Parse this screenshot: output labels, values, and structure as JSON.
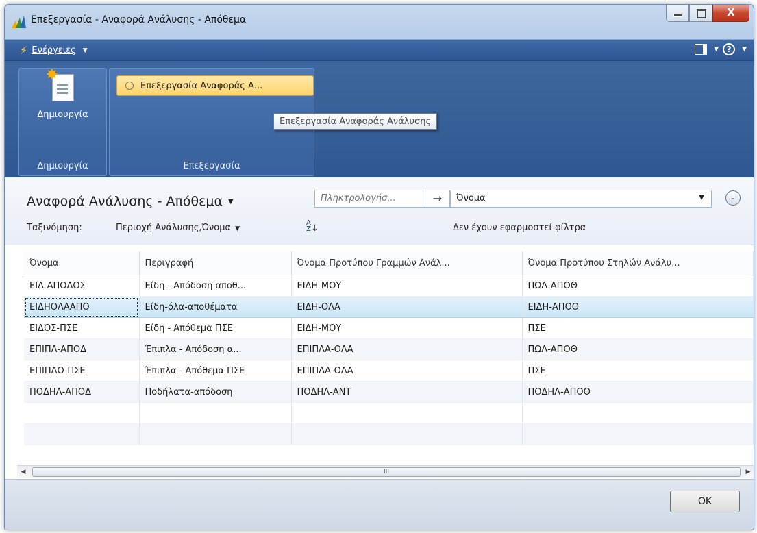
{
  "window": {
    "title": "Επεξεργασία - Αναφορά Ανάλυσης - Απόθεμα",
    "close_glyph": "X"
  },
  "actions_bar": {
    "actions_label": "Ενέργειες",
    "help_glyph": "?"
  },
  "ribbon": {
    "new_group": {
      "button_label": "Δημιουργία",
      "group_label": "Δημιουργία"
    },
    "edit_group": {
      "button_label": "Επεξεργασία Αναφοράς Α...",
      "group_label": "Επεξεργασία"
    },
    "tooltip": "Επεξεργασία Αναφοράς Ανάλυσης"
  },
  "page": {
    "title": "Αναφορά Ανάλυσης - Απόθεμα",
    "search": {
      "placeholder": "Πληκτρολογήσ...",
      "field": "Όνομα"
    },
    "sort_label": "Ταξινόμηση:",
    "sort_value": "Περιοχή Ανάλυσης,Όνομα",
    "filter_status": "Δεν έχουν εφαρμοστεί φίλτρα"
  },
  "table": {
    "columns": [
      "Όνομα",
      "Περιγραφή",
      "Όνομα Προτύπου Γραμμών Ανάλ...",
      "Όνομα Προτύπου Στηλών Ανάλυ..."
    ],
    "rows": [
      [
        "ΕΙΔ-ΑΠΟΔΟΣ",
        "Είδη - Απόδοση αποθ...",
        "ΕΙΔΗ-ΜΟΥ",
        "ΠΩΛ-ΑΠΟΘ"
      ],
      [
        "ΕΙΔΗΟΛΑΑΠΟ",
        "Είδη-όλα-αποθέματα",
        "ΕΙΔΗ-ΟΛΑ",
        "ΕΙΔΗ-ΑΠΟΘ"
      ],
      [
        "ΕΙΔΟΣ-ΠΣΕ",
        "Είδη - Απόθεμα ΠΣΕ",
        "ΕΙΔΗ-ΜΟΥ",
        "ΠΣΕ"
      ],
      [
        "ΕΠΙΠΛ-ΑΠΟΔ",
        "Έπιπλα - Απόδοση α...",
        "ΕΠΙΠΛΑ-ΟΛΑ",
        "ΠΩΛ-ΑΠΟΘ"
      ],
      [
        "ΕΠΙΠΛΟ-ΠΣΕ",
        "Έπιπλα - Απόθεμα ΠΣΕ",
        "ΕΠΙΠΛΑ-ΟΛΑ",
        "ΠΣΕ"
      ],
      [
        "ΠΟΔΗΛ-ΑΠΟΔ",
        "Ποδήλατα-απόδοση",
        "ΠΟΔΗΛ-ΑΝΤ",
        "ΠΟΔΗΛ-ΑΠΟΘ"
      ]
    ],
    "selected_row": 1,
    "scroll_thumb": "III"
  },
  "footer": {
    "ok_label": "OK"
  }
}
